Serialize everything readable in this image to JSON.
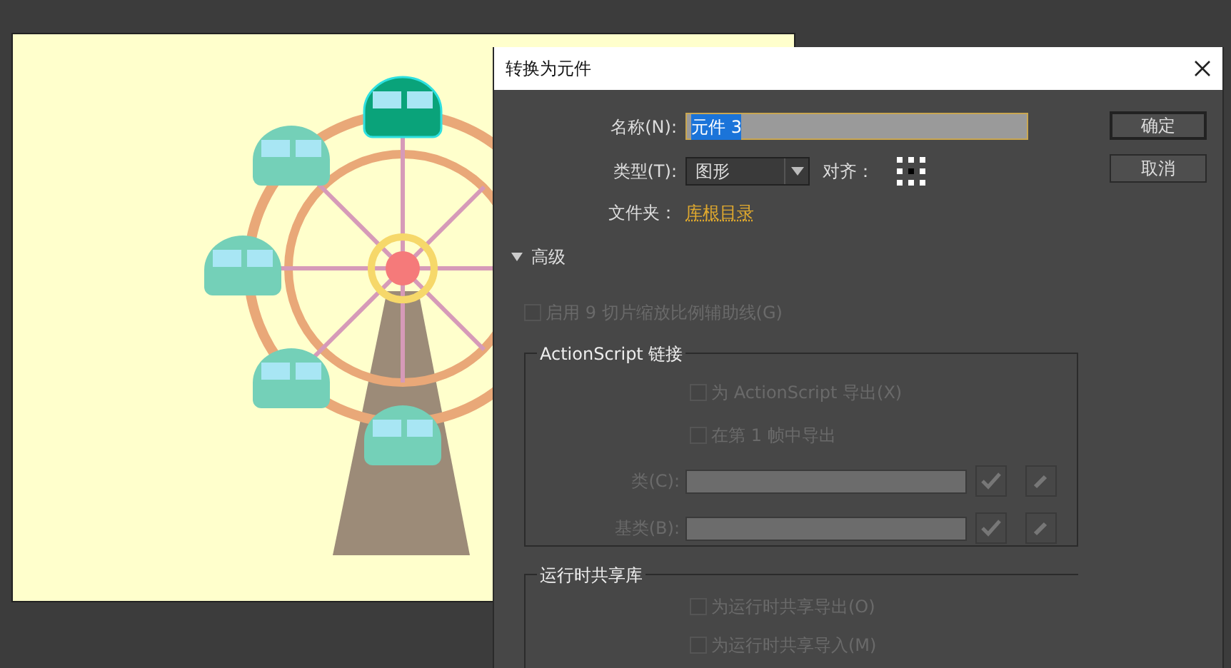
{
  "dialog": {
    "title": "转换为元件",
    "name": {
      "label": "名称(N):",
      "value": "元件 3",
      "text_selected": true
    },
    "type": {
      "label": "类型(T):",
      "value": "图形"
    },
    "align": {
      "label": "对齐："
    },
    "folder": {
      "label": "文件夹：",
      "link": "库根目录"
    },
    "buttons": [
      {
        "label": "确定",
        "default": true
      },
      {
        "label": "取消",
        "default": false
      }
    ],
    "advanced": {
      "label": "高级",
      "expanded": true,
      "scale9": {
        "label": "启用 9 切片缩放比例辅助线(G)",
        "checked": false,
        "disabled": true
      },
      "actionscript": {
        "title": "ActionScript 链接",
        "options": [
          {
            "label": "为 ActionScript 导出(X)",
            "checked": false,
            "disabled": true
          },
          {
            "label": "在第 1 帧中导出",
            "checked": false,
            "disabled": true
          }
        ],
        "fields": [
          {
            "label": "类(C):",
            "disabled": true
          },
          {
            "label": "基类(B):",
            "disabled": true
          }
        ]
      },
      "runtime": {
        "title": "运行时共享库",
        "options": [
          {
            "label": "为运行时共享导出(O)",
            "checked": false,
            "disabled": true
          },
          {
            "label": "为运行时共享导入(M)",
            "checked": false,
            "disabled": true
          }
        ]
      }
    }
  }
}
